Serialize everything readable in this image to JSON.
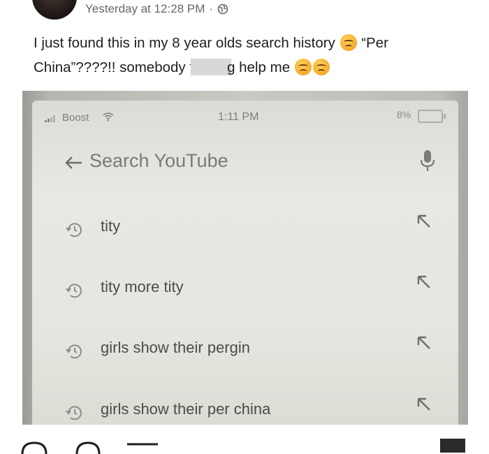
{
  "post": {
    "timestamp": "Yesterday at 12:28 PM",
    "separator": "·",
    "text_part1": "I just found this in my 8 year olds search history ",
    "text_part2": " “Per China”????!! somebody f",
    "text_part3": "g help me "
  },
  "phone": {
    "carrier": "Boost",
    "time": "1:11 PM",
    "battery": "8%",
    "search_placeholder": "Search YouTube",
    "history": [
      {
        "label": "tity"
      },
      {
        "label": "tity more tity"
      },
      {
        "label": "girls show their pergin"
      },
      {
        "label": "girls show their per china"
      }
    ]
  },
  "icons": {
    "privacy": "globe-icon",
    "reaction": "persevering-face-emoji",
    "back": "arrow-left-icon",
    "mic": "microphone-icon",
    "history": "history-clock-icon",
    "fill": "arrow-up-left-icon"
  }
}
